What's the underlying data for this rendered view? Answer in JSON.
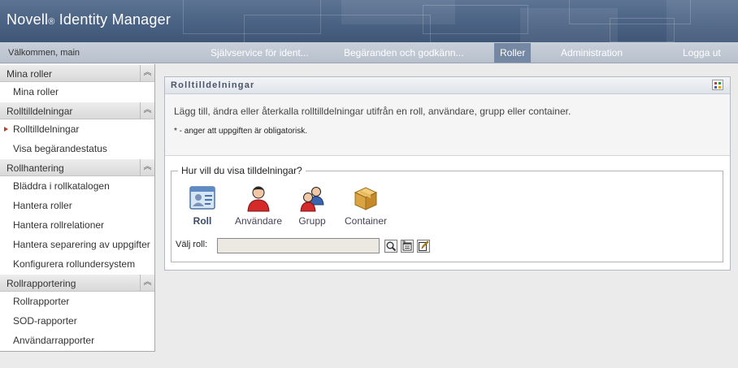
{
  "banner": {
    "brand": "Novell",
    "reg_mark": "®",
    "product": " Identity Manager"
  },
  "nav": {
    "welcome": "Välkommen, main",
    "tabs": [
      {
        "label": "Självservice för ident..."
      },
      {
        "label": "Begäranden och godkänn..."
      },
      {
        "label": "Roller"
      },
      {
        "label": "Administration"
      },
      {
        "label": "Logga ut"
      }
    ],
    "active_tab": "Roller"
  },
  "sidebar": {
    "sections": [
      {
        "header": "Mina roller",
        "items": [
          "Mina roller"
        ]
      },
      {
        "header": "Rolltilldelningar",
        "items": [
          "Rolltilldelningar",
          "Visa begärandestatus"
        ]
      },
      {
        "header": "Rollhantering",
        "items": [
          "Bläddra i rollkatalogen",
          "Hantera roller",
          "Hantera rollrelationer",
          "Hantera separering av uppgifter",
          "Konfigurera rollundersystem"
        ]
      },
      {
        "header": "Rollrapportering",
        "items": [
          "Rollrapporter",
          "SOD-rapporter",
          "Användarrapporter"
        ]
      }
    ],
    "current_item": "Rolltilldelningar"
  },
  "portlet": {
    "title": "Rolltilldelningar",
    "intro": "Lägg till, ändra eller återkalla rolltilldelningar utifrån en roll, användare, grupp eller container.",
    "required_note": "* - anger att uppgiften är obligatorisk.",
    "legend": "Hur vill du visa tilldelningar?",
    "options": [
      {
        "label": "Roll",
        "icon": "role-card-icon"
      },
      {
        "label": "Användare",
        "icon": "user-icon"
      },
      {
        "label": "Grupp",
        "icon": "group-icon"
      },
      {
        "label": "Container",
        "icon": "container-box-icon"
      }
    ],
    "selected_option": "Roll",
    "role_label": "Välj roll:",
    "role_value": "",
    "buttons": [
      {
        "icon": "search-icon"
      },
      {
        "icon": "history-list-icon"
      },
      {
        "icon": "edit-pencil-icon"
      }
    ]
  },
  "colors": {
    "banner": "#4a6283",
    "nav_active": "#7488a3",
    "current_marker": "#c0392b"
  }
}
